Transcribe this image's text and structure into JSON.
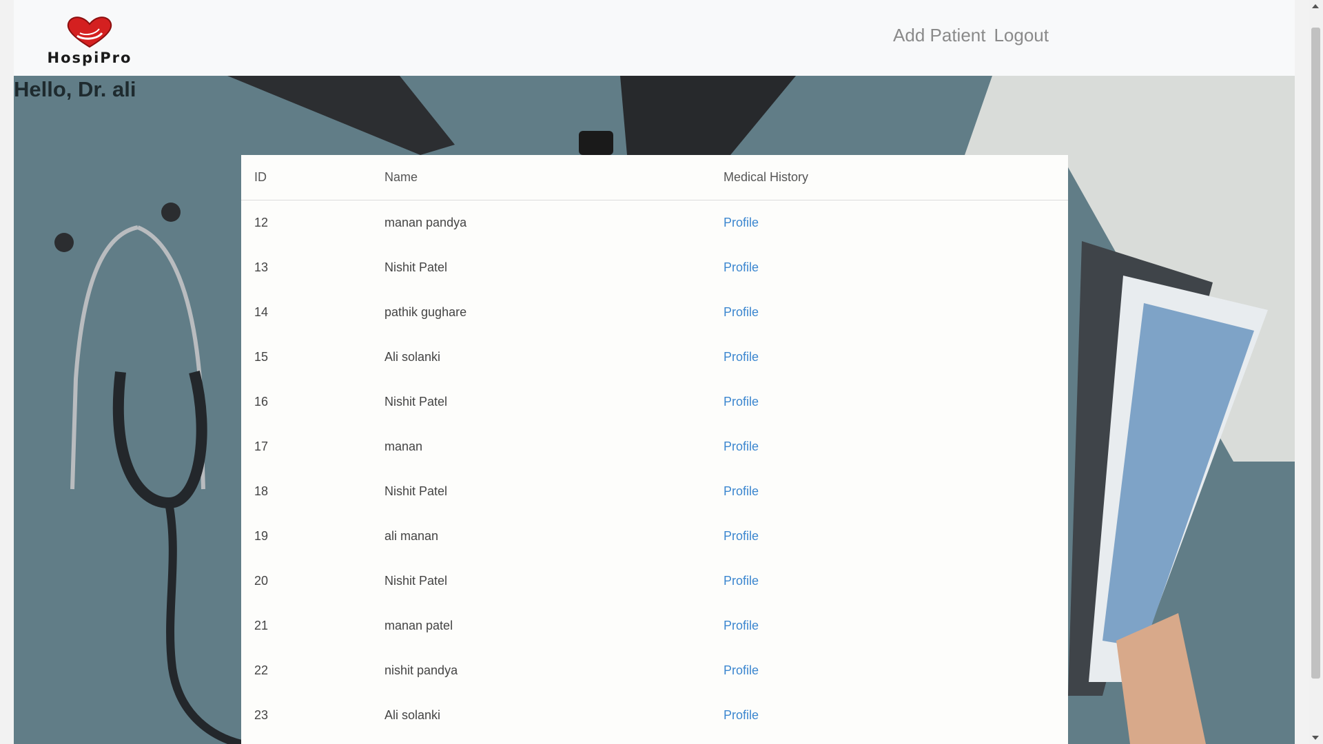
{
  "navbar": {
    "logo_text": "HospiPro",
    "links": [
      {
        "label": "Add Patient"
      },
      {
        "label": "Logout"
      }
    ]
  },
  "greeting": "Hello, Dr. ali",
  "table": {
    "headers": {
      "id": "ID",
      "name": "Name",
      "history": "Medical History"
    },
    "rows": [
      {
        "id": "12",
        "name": "manan pandya",
        "link": "Profile"
      },
      {
        "id": "13",
        "name": "Nishit Patel",
        "link": "Profile"
      },
      {
        "id": "14",
        "name": "pathik gughare",
        "link": "Profile"
      },
      {
        "id": "15",
        "name": "Ali solanki",
        "link": "Profile"
      },
      {
        "id": "16",
        "name": "Nishit Patel",
        "link": "Profile"
      },
      {
        "id": "17",
        "name": "manan",
        "link": "Profile"
      },
      {
        "id": "18",
        "name": "Nishit Patel",
        "link": "Profile"
      },
      {
        "id": "19",
        "name": "ali manan",
        "link": "Profile"
      },
      {
        "id": "20",
        "name": "Nishit Patel",
        "link": "Profile"
      },
      {
        "id": "21",
        "name": "manan patel",
        "link": "Profile"
      },
      {
        "id": "22",
        "name": "nishit pandya",
        "link": "Profile"
      },
      {
        "id": "23",
        "name": "Ali solanki",
        "link": "Profile"
      }
    ]
  },
  "colors": {
    "navbar_bg": "#f8f9fa",
    "hero_bg": "#617d87",
    "link": "#3b86cf",
    "nav_link": "#8a8a8a"
  },
  "icons": {
    "logo": "heart-hands-icon"
  }
}
